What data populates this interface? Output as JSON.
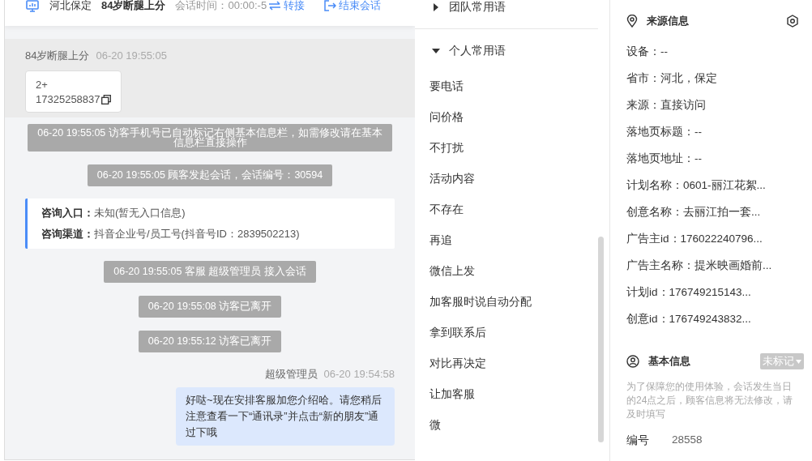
{
  "header": {
    "location": "河北保定",
    "visitor": "84岁断腿上分",
    "session_time": "会话时间：00:00:-5",
    "actions": [
      {
        "label": "转接",
        "kind": "transfer"
      },
      {
        "label": "结束会话",
        "kind": "end"
      }
    ]
  },
  "messages": [
    {
      "kind": "visitor",
      "sender": "84岁断腿上分",
      "time": "06-20 19:55:05",
      "lines": [
        "2+",
        "17325258837"
      ]
    },
    {
      "kind": "system",
      "text": "06-20 19:55:05 访客手机号已自动标记右侧基本信息栏，如需修改请在基本信息栏直接操作"
    },
    {
      "kind": "system",
      "text": "06-20 19:55:05 顾客发起会话，会话编号：30594"
    },
    {
      "kind": "info",
      "rows": [
        {
          "label": "咨询入口：",
          "value": "未知(暂无入口信息)"
        },
        {
          "label": "咨询渠道：",
          "value": "抖音企业号/员工号(抖音号ID：2839502213)"
        }
      ]
    },
    {
      "kind": "system",
      "text": "06-20 19:55:05 客服 超级管理员 接入会话"
    },
    {
      "kind": "system",
      "text": "06-20 19:55:08 访客已离开"
    },
    {
      "kind": "system",
      "text": "06-20 19:55:12 访客已离开"
    },
    {
      "kind": "agent",
      "sender": "超级管理员",
      "time": "06-20 19:54:58",
      "text": "好哒~现在安排客服加您介绍哈。请您稍后注意查看一下“通讯录”并点击“新的朋友”通过下哦"
    }
  ],
  "phrases": [
    {
      "title": "团队常用语",
      "expanded": false
    },
    {
      "title": "个人常用语",
      "expanded": true,
      "items": [
        "要电话",
        "问价格",
        "不打扰",
        "活动内容",
        "不存在",
        "再追",
        "微信上发",
        "加客服时说自动分配",
        "拿到联系后",
        "对比再决定",
        "让加客服",
        "微"
      ]
    }
  ],
  "source_info": {
    "title": "来源信息",
    "fields": [
      "设备：--",
      "省市：河北，保定",
      "来源：直接访问",
      "落地页标题：--",
      "落地页地址：--",
      "计划名称：0601-丽江花絮...",
      "创意名称：去丽江拍一套...",
      "广告主id：176022240796...",
      "广告主名称：提米映画婚前...",
      "计划id：176749215143...",
      "创意id：176749243832..."
    ]
  },
  "basic_info": {
    "title": "基本信息",
    "tag": "未标记",
    "note": "为了保障您的使用体验，会话发生当日的24点之后，顾客信息将无法修改，请及时填写",
    "fields": [
      {
        "label": "编号",
        "value": "28558"
      }
    ]
  }
}
